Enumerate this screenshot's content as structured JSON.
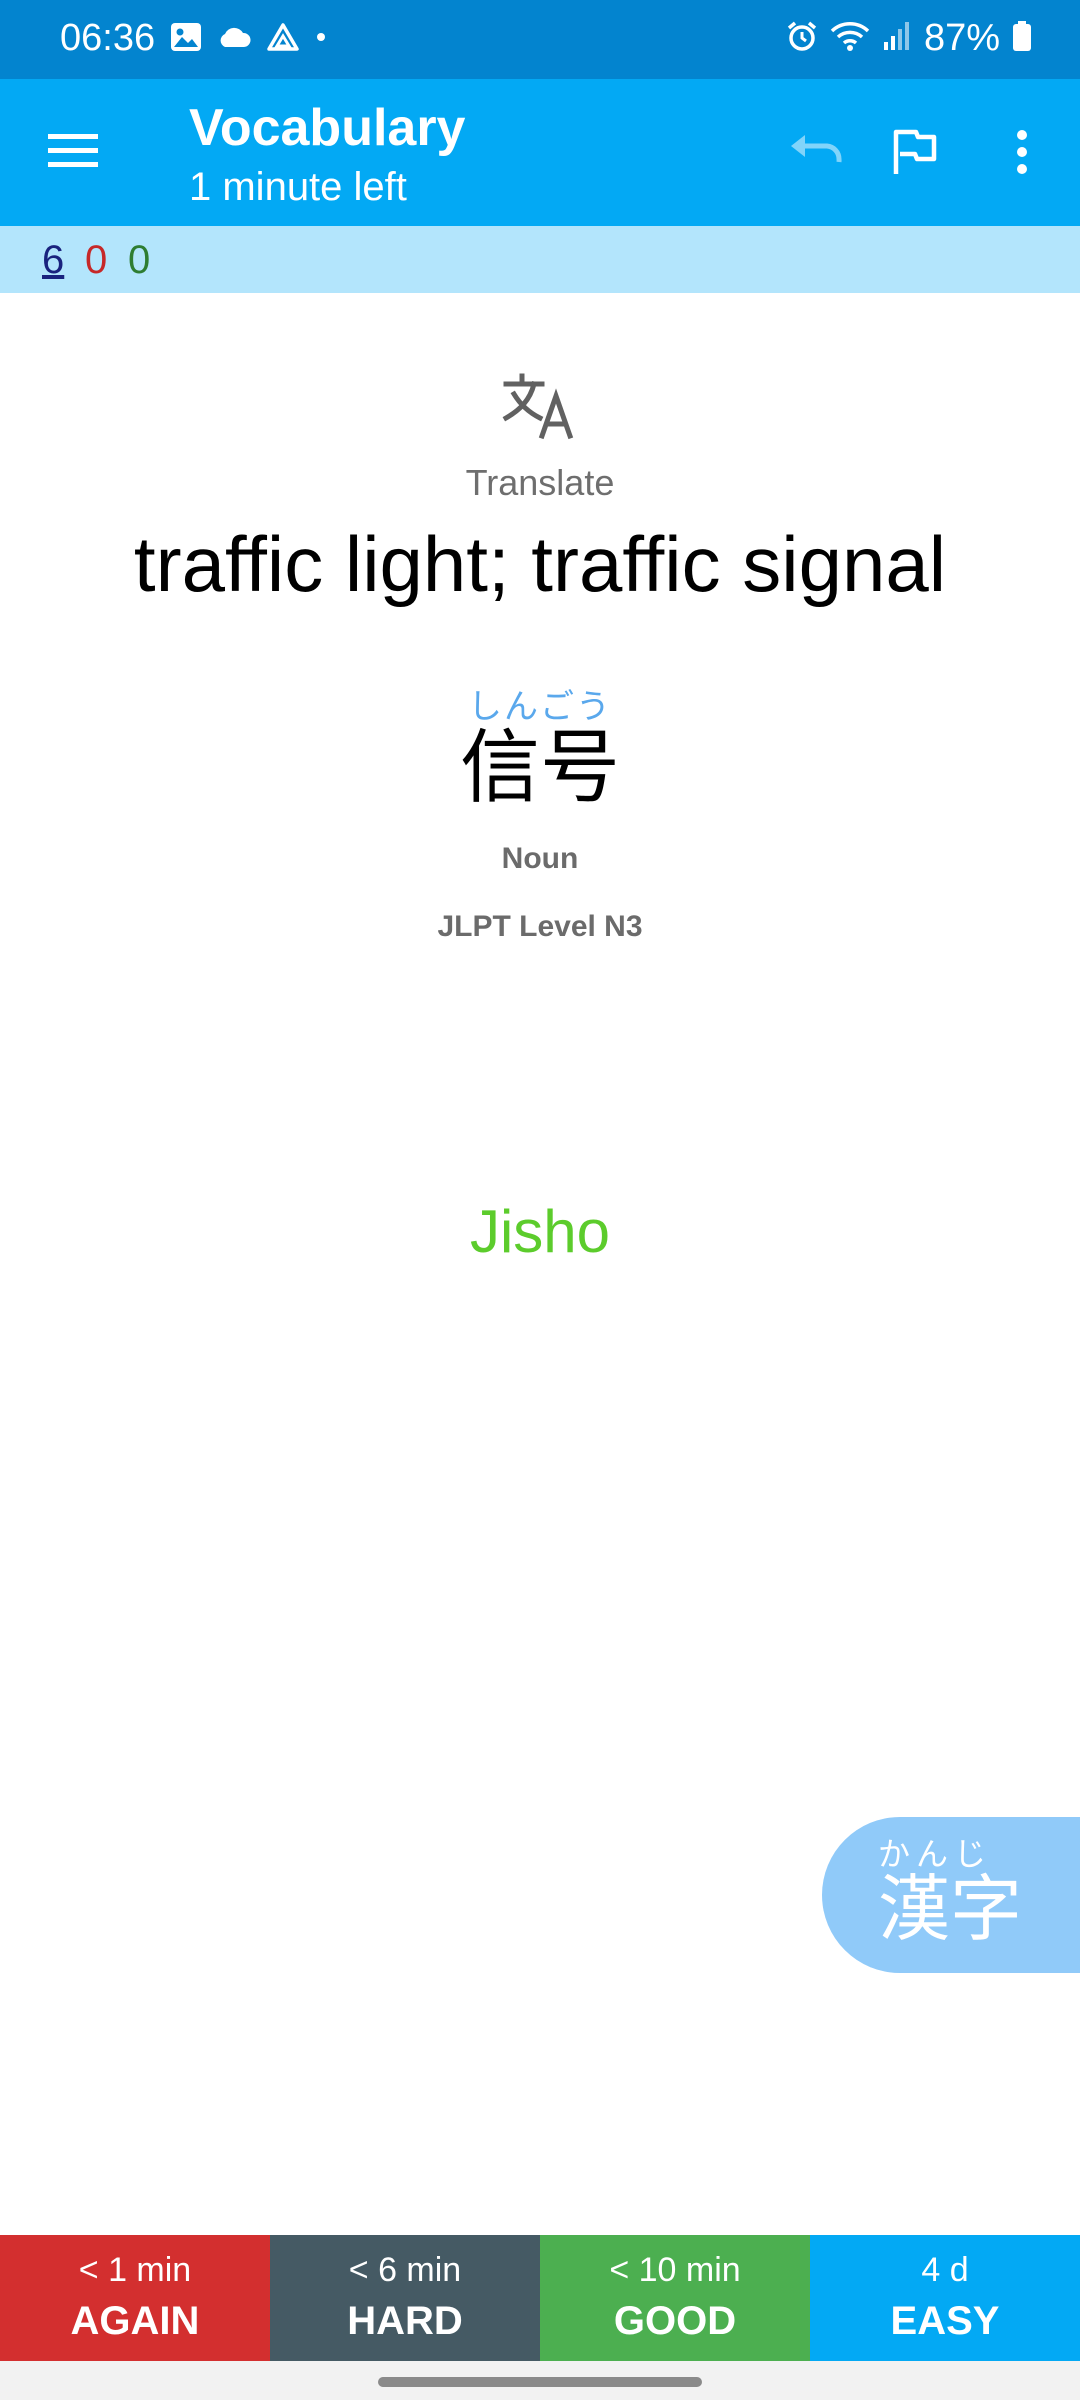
{
  "status_bar": {
    "time": "06:36",
    "battery": "87%",
    "icons": [
      "gallery-icon",
      "cloud-icon",
      "drive-icon",
      "dot-icon",
      "alarm-icon",
      "wifi-icon",
      "signal-icon",
      "battery-icon"
    ]
  },
  "app_bar": {
    "title": "Vocabulary",
    "subtitle": "1 minute left",
    "icons": [
      "menu-icon",
      "undo-icon",
      "flag-icon",
      "more-vert-icon"
    ]
  },
  "counts": {
    "new": "6",
    "learning": "0",
    "review": "0"
  },
  "card": {
    "prompt_label": "Translate",
    "meaning": "traffic light; traffic signal",
    "reading": "しんごう",
    "word": "信号",
    "part_of_speech": "Noun",
    "jlpt": "JLPT Level N3",
    "link": "Jisho"
  },
  "kanji_button": {
    "reading": "かんじ",
    "text": "漢字"
  },
  "answers": [
    {
      "interval": "< 1 min",
      "label": "AGAIN",
      "color": "#d32f2f"
    },
    {
      "interval": "< 6 min",
      "label": "HARD",
      "color": "#455a64"
    },
    {
      "interval": "< 10 min",
      "label": "GOOD",
      "color": "#4caf50"
    },
    {
      "interval": "4 d",
      "label": "EASY",
      "color": "#03a9f4"
    }
  ],
  "colors": {
    "status_bar": "#0384cf",
    "app_bar": "#03a9f4",
    "count_bar": "#b3e5fc",
    "link": "#5ccc2c",
    "reading": "#5aa8ec",
    "kanji_button": "#90caf9"
  }
}
